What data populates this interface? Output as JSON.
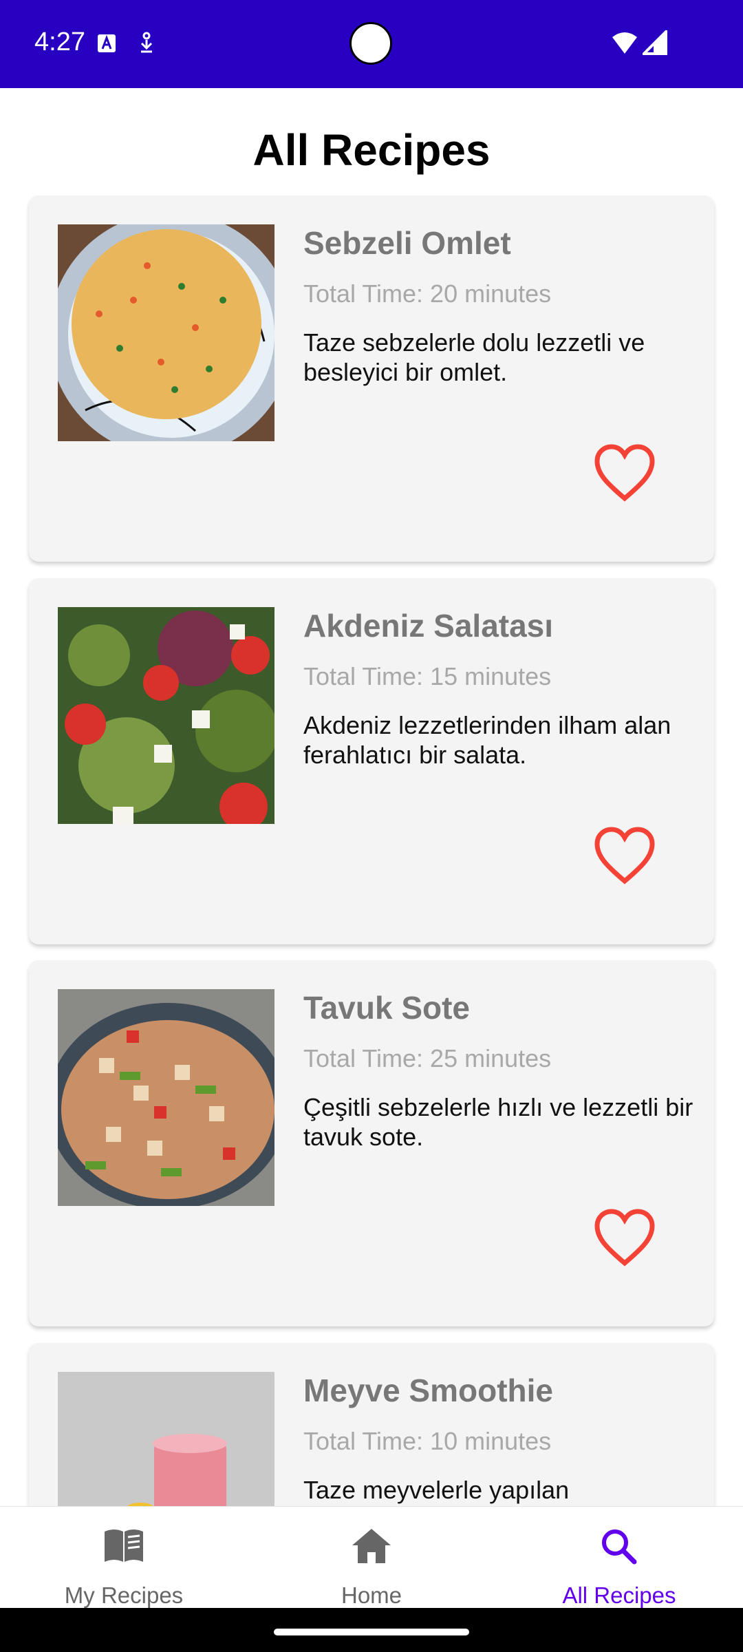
{
  "status": {
    "time": "4:27"
  },
  "page": {
    "title": "All Recipes"
  },
  "recipes": [
    {
      "title": "Sebzeli Omlet",
      "time": "Total Time: 20 minutes",
      "description": "Taze sebzelerle dolu lezzetli ve besleyici bir omlet."
    },
    {
      "title": "Akdeniz Salatası",
      "time": "Total Time: 15 minutes",
      "description": "Akdeniz lezzetlerinden ilham alan ferahlatıcı bir salata."
    },
    {
      "title": "Tavuk Sote",
      "time": "Total Time: 25 minutes",
      "description": "Çeşitli sebzelerle hızlı ve lezzetli bir tavuk sote."
    },
    {
      "title": "Meyve Smoothie",
      "time": "Total Time: 10 minutes",
      "description": "Taze meyvelerle yapılan"
    }
  ],
  "nav": {
    "items": [
      {
        "label": "My Recipes",
        "icon": "book-icon"
      },
      {
        "label": "Home",
        "icon": "home-icon"
      },
      {
        "label": "All Recipes",
        "icon": "search-icon"
      }
    ],
    "active": "All Recipes"
  },
  "colors": {
    "status_bar": "#2700c2",
    "accent": "#6200ee",
    "heart": "#f44336",
    "card_bg": "#f4f4f4"
  }
}
